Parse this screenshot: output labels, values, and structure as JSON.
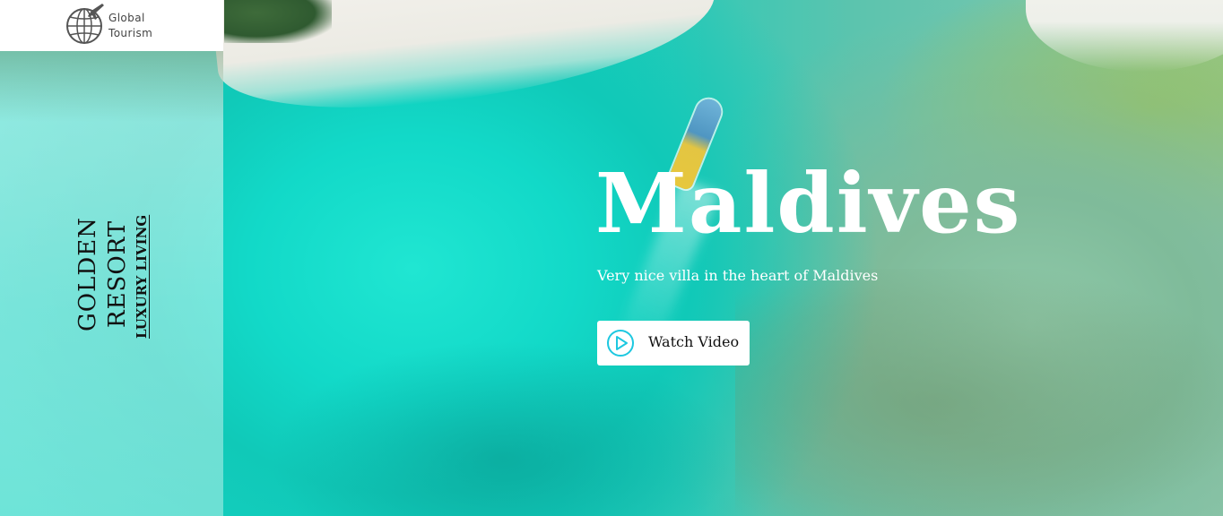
{
  "brand": {
    "line1": "Global",
    "line2": "Tourism",
    "icon": "globe-airplane-icon"
  },
  "sidebar": {
    "word1": "GOLDEN",
    "word2": "RESORT",
    "tagline": "LUXURY LIVING"
  },
  "hero": {
    "title": "Maldives",
    "subtitle": "Very nice villa in the heart of Maldives",
    "cta_label": "Watch Video",
    "cta_icon": "play-circle-icon"
  },
  "colors": {
    "accent": "#1ec8e0",
    "water": "#13cdbd",
    "text_dark": "#111111",
    "text_light": "#ffffff"
  }
}
